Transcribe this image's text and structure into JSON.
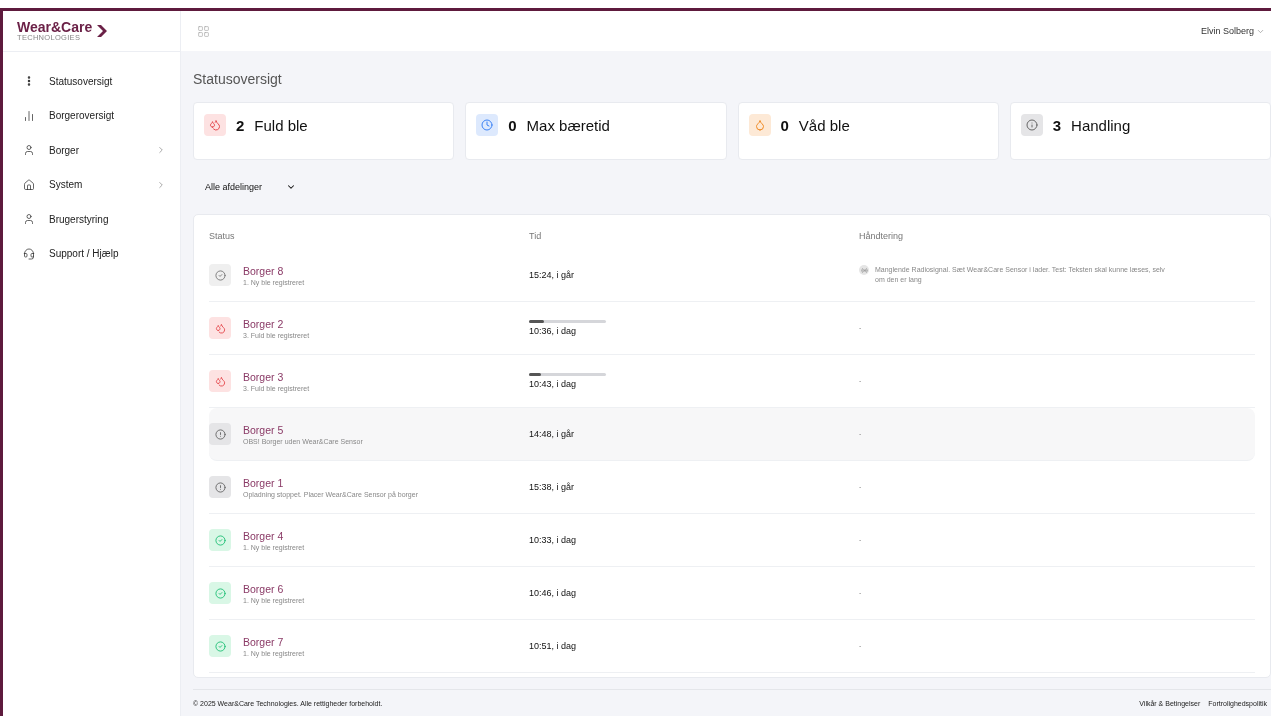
{
  "logo": {
    "name": "Wear&Care",
    "tagline": "TECHNOLOGIES"
  },
  "sidebar": {
    "items": [
      {
        "label": "Statusoversigt",
        "kind": "dots",
        "expandable": false
      },
      {
        "label": "Borgeroversigt",
        "kind": "chart",
        "expandable": false
      },
      {
        "label": "Borger",
        "kind": "user",
        "expandable": true
      },
      {
        "label": "System",
        "kind": "home",
        "expandable": true
      },
      {
        "label": "Brugerstyring",
        "kind": "user",
        "expandable": false
      },
      {
        "label": "Support / Hjælp",
        "kind": "headset",
        "expandable": false
      }
    ]
  },
  "header": {
    "user": "Elvin Solberg"
  },
  "page_title": "Statusoversigt",
  "stats": [
    {
      "kind": "full",
      "count": "2",
      "label": "Fuld ble"
    },
    {
      "kind": "time",
      "count": "0",
      "label": "Max bæretid"
    },
    {
      "kind": "wet",
      "count": "0",
      "label": "Våd ble"
    },
    {
      "kind": "action",
      "count": "3",
      "label": "Handling"
    }
  ],
  "filter": {
    "value": "Alle afdelinger"
  },
  "table": {
    "columns": [
      "Status",
      "Tid",
      "Håndtering"
    ],
    "rows": [
      {
        "kind": "idle",
        "name": "Borger 8",
        "detail": "1. Ny ble registreret",
        "time": "15:24, i går",
        "handling": "Manglende Radiosignal. Sæt Wear&Care Sensor i lader. Test: Teksten skal kunne læses, selv om den er lang",
        "signal_icon": true,
        "selected": false
      },
      {
        "kind": "full",
        "name": "Borger 2",
        "detail": "3. Fuld ble registreret",
        "time": "10:36, i dag",
        "level": 0.2,
        "handling": "-",
        "signal_icon": false,
        "selected": false
      },
      {
        "kind": "full",
        "name": "Borger 3",
        "detail": "3. Fuld ble registreret",
        "time": "10:43, i dag",
        "level": 0.15,
        "handling": "-",
        "signal_icon": false,
        "selected": false
      },
      {
        "kind": "alert",
        "name": "Borger 5",
        "detail": "OBS! Borger uden Wear&Care Sensor",
        "time": "14:48, i går",
        "handling": "-",
        "signal_icon": false,
        "selected": true
      },
      {
        "kind": "alert",
        "name": "Borger 1",
        "detail": "Opladning stoppet. Placer Wear&Care Sensor på borger",
        "time": "15:38, i går",
        "handling": "-",
        "signal_icon": false,
        "selected": false
      },
      {
        "kind": "ok",
        "name": "Borger 4",
        "detail": "1. Ny ble registreret",
        "time": "10:33, i dag",
        "handling": "-",
        "signal_icon": false,
        "selected": false
      },
      {
        "kind": "ok",
        "name": "Borger 6",
        "detail": "1. Ny ble registreret",
        "time": "10:46, i dag",
        "handling": "-",
        "signal_icon": false,
        "selected": false
      },
      {
        "kind": "ok",
        "name": "Borger 7",
        "detail": "1. Ny ble registreret",
        "time": "10:51, i dag",
        "handling": "-",
        "signal_icon": false,
        "selected": false
      }
    ]
  },
  "footer": {
    "copyright": "© 2025 Wear&Care Technologies. Alle rettigheder forbeholdt.",
    "links": [
      "Vilkår & Betingelser",
      "Fortrolighedspolitik"
    ]
  }
}
